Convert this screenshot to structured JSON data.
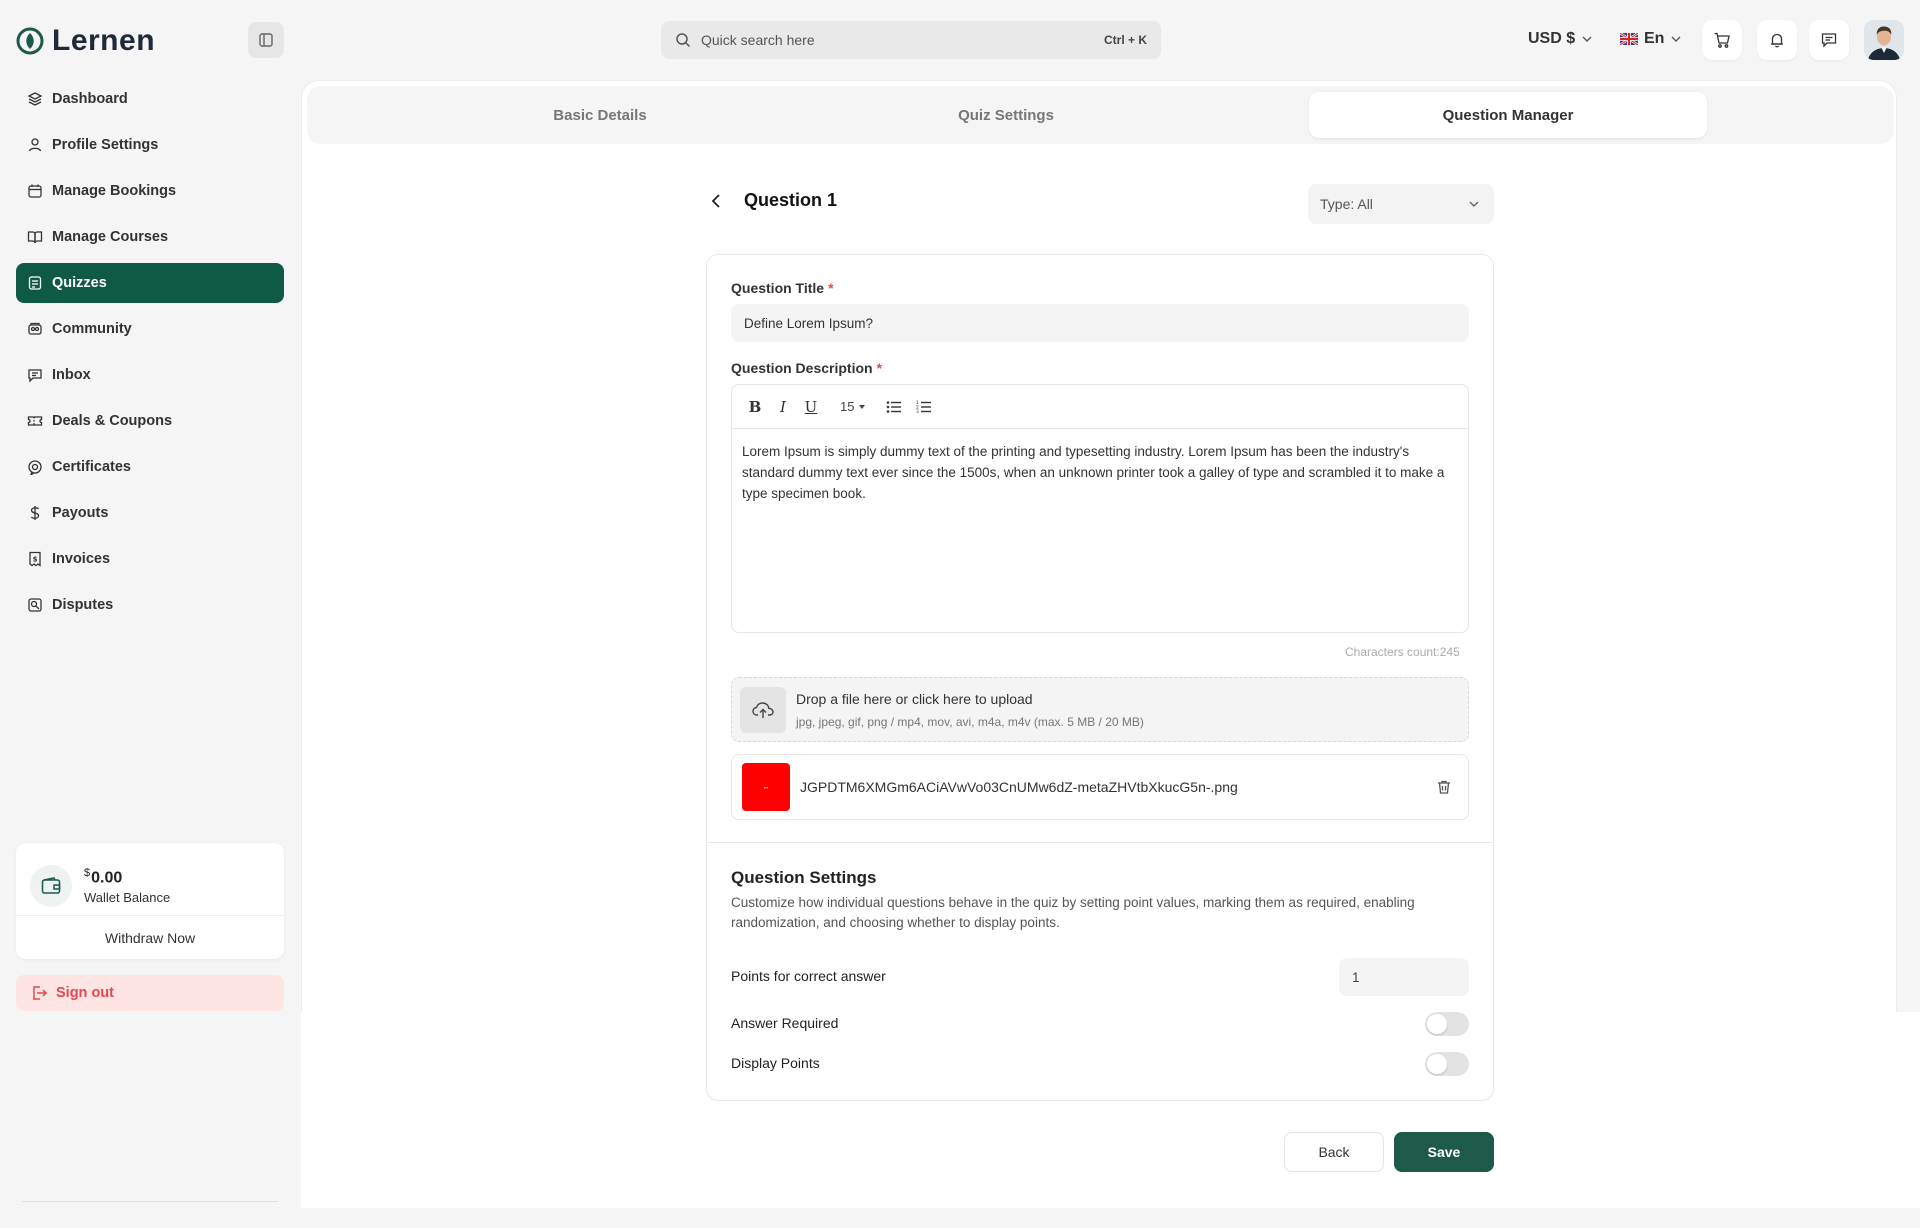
{
  "app": {
    "name": "Lernen"
  },
  "sidebar": {
    "items": [
      {
        "label": "Dashboard",
        "icon": "layers-icon"
      },
      {
        "label": "Profile Settings",
        "icon": "user-icon"
      },
      {
        "label": "Manage Bookings",
        "icon": "calendar-icon"
      },
      {
        "label": "Manage Courses",
        "icon": "book-icon"
      },
      {
        "label": "Quizzes",
        "icon": "quiz-icon",
        "active": true
      },
      {
        "label": "Community",
        "icon": "community-icon"
      },
      {
        "label": "Inbox",
        "icon": "chat-icon"
      },
      {
        "label": "Deals & Coupons",
        "icon": "ticket-icon"
      },
      {
        "label": "Certificates",
        "icon": "certificate-icon"
      },
      {
        "label": "Payouts",
        "icon": "dollar-icon"
      },
      {
        "label": "Invoices",
        "icon": "invoice-icon"
      },
      {
        "label": "Disputes",
        "icon": "dispute-icon"
      }
    ],
    "wallet": {
      "currency_symbol": "$",
      "amount": "0.00",
      "label": "Wallet Balance",
      "withdraw_label": "Withdraw Now"
    },
    "signout_label": "Sign out"
  },
  "header": {
    "search_placeholder": "Quick search here",
    "search_shortcut": "Ctrl + K",
    "currency": "USD $",
    "language": "En"
  },
  "tabs": [
    {
      "label": "Basic Details"
    },
    {
      "label": "Quiz Settings"
    },
    {
      "label": "Question Manager",
      "active": true
    }
  ],
  "question": {
    "heading": "Question 1",
    "type_filter": "Type: All",
    "title_label": "Question Title",
    "title_value": "Define Lorem Ipsum?",
    "description_label": "Question Description",
    "font_size": "15",
    "description_text": "Lorem Ipsum is simply dummy text of the printing and typesetting industry. Lorem Ipsum has been the industry's standard dummy text ever since the 1500s, when an unknown printer took a galley of type and scrambled it to make a type specimen book.",
    "char_count_label": "Characters count:",
    "char_count_value": "245",
    "upload_title": "Drop a file here or click here to upload",
    "upload_hint": "jpg, jpeg, gif, png / mp4, mov, avi, m4a, m4v (max. 5 MB / 20 MB)",
    "file_name": "JGPDTM6XMGm6ACiAVwVo03CnUMw6dZ-metaZHVtbXkucG5n-.png",
    "required_mark": "*"
  },
  "settings": {
    "title": "Question Settings",
    "description": "Customize how individual questions behave in the quiz by setting point values, marking them as required, enabling randomization, and choosing whether to display points.",
    "points_label": "Points for correct answer",
    "points_value": "1",
    "answer_required_label": "Answer Required",
    "answer_required": false,
    "display_points_label": "Display Points",
    "display_points": false
  },
  "actions": {
    "back_label": "Back",
    "save_label": "Save"
  },
  "colors": {
    "primary": "#0e5a45",
    "save": "#1d5a4a",
    "danger": "#e4484f"
  }
}
